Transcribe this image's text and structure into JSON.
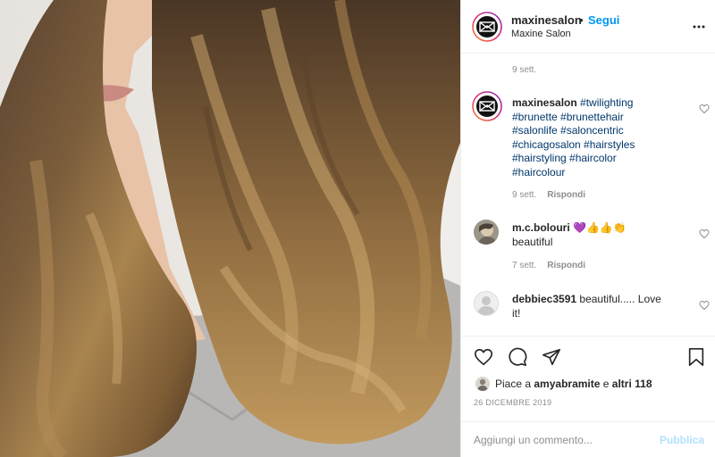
{
  "header": {
    "username": "maxinesalon",
    "separator": "•",
    "follow_label": "Segui",
    "full_name": "Maxine Salon",
    "more_icon": "more-dots-icon"
  },
  "comments": {
    "top_timestamp": "9 sett.",
    "items": [
      {
        "username": "maxinesalon",
        "text_lines": [
          "#twilighting",
          "#brunette #brunettehair",
          "#salonlife #saloncentric",
          "#chicagosalon #hairstyles",
          "#hairstyling #haircolor",
          "#haircolour"
        ],
        "time": "9 sett.",
        "reply_label": "Rispondi"
      },
      {
        "username": "m.c.bolouri",
        "emoji": "💜👍👍👏",
        "text": "beautiful",
        "time": "7 sett.",
        "reply_label": "Rispondi"
      },
      {
        "username": "debbiec3591",
        "text_line1": "beautiful..... Love",
        "text_line2": "it!"
      }
    ]
  },
  "actions": {
    "like_icon": "heart-icon",
    "comment_icon": "comment-bubble-icon",
    "share_icon": "paper-plane-icon",
    "save_icon": "bookmark-icon",
    "likes_prefix": "Piace a",
    "likes_user": "amyabramite",
    "likes_conj": "e",
    "likes_others": "altri 118",
    "date": "26 DICEMBRE 2019"
  },
  "add_comment": {
    "placeholder": "Aggiungi un commento...",
    "publish_label": "Pubblica"
  },
  "colors": {
    "link_blue": "#0095f6",
    "hashtag": "#00376b",
    "muted": "#8e8e8e",
    "publish_disabled": "#b2dffc"
  }
}
